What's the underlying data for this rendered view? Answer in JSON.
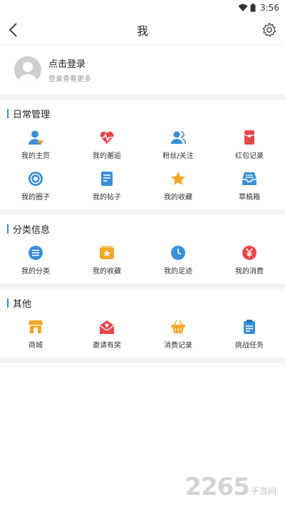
{
  "status": {
    "time": "3:56"
  },
  "nav": {
    "title": "我"
  },
  "profile": {
    "login": "点击登录",
    "sub": "登录查看更多"
  },
  "sections": [
    {
      "title": "日常管理",
      "items": [
        {
          "label": "我的主页",
          "icon": "user-icon"
        },
        {
          "label": "我的邂逅",
          "icon": "heartbeat-icon"
        },
        {
          "label": "粉丝/关注",
          "icon": "users-icon"
        },
        {
          "label": "红包记录",
          "icon": "red-envelope-icon"
        },
        {
          "label": "我的圈子",
          "icon": "circle-target-icon"
        },
        {
          "label": "我的帖子",
          "icon": "post-icon"
        },
        {
          "label": "我的收藏",
          "icon": "star-icon"
        },
        {
          "label": "草稿箱",
          "icon": "inbox-icon"
        }
      ]
    },
    {
      "title": "分类信息",
      "items": [
        {
          "label": "我的分类",
          "icon": "list-icon"
        },
        {
          "label": "我的收藏",
          "icon": "star-folder-icon"
        },
        {
          "label": "我的足迹",
          "icon": "clock-icon"
        },
        {
          "label": "我的消费",
          "icon": "yen-icon"
        }
      ]
    },
    {
      "title": "其他",
      "items": [
        {
          "label": "商城",
          "icon": "shop-icon"
        },
        {
          "label": "邀请有奖",
          "icon": "invite-mail-icon"
        },
        {
          "label": "消费记录",
          "icon": "basket-icon"
        },
        {
          "label": "挑战任务",
          "icon": "clipboard-icon"
        }
      ]
    }
  ],
  "watermark": {
    "num": "2265",
    "text": "手游网"
  },
  "colors": {
    "accent": "#2f8fe0",
    "red": "#e8474a",
    "orange": "#f5a623",
    "blue": "#3a8fd9"
  }
}
